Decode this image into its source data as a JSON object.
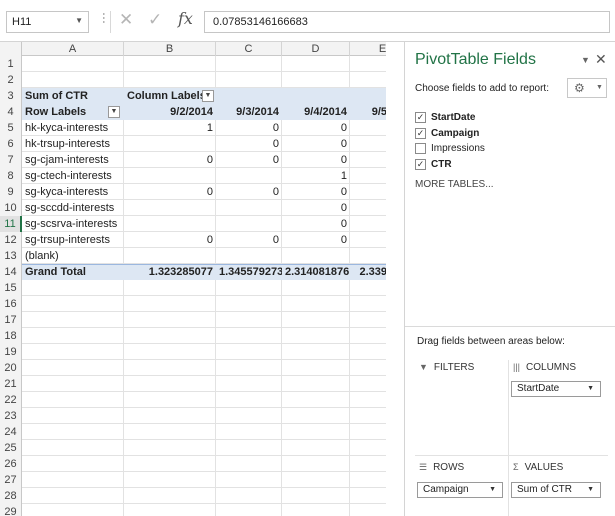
{
  "formula_bar": {
    "name_box": "H11",
    "formula": "0.07853146166683"
  },
  "grid": {
    "columns": [
      "A",
      "B",
      "C",
      "D",
      "E"
    ],
    "active_row": "11",
    "rows": [
      {
        "n": "1",
        "a": "",
        "b": "",
        "c": "",
        "d": "",
        "e": ""
      },
      {
        "n": "2",
        "a": "",
        "b": "",
        "c": "",
        "d": "",
        "e": ""
      },
      {
        "n": "3",
        "a": "Sum of CTR",
        "b": "Column Labels",
        "c": "",
        "d": "",
        "e": ""
      },
      {
        "n": "4",
        "a": "Row Labels",
        "b": "9/2/2014",
        "c": "9/3/2014",
        "d": "9/4/2014",
        "e": "9/5"
      },
      {
        "n": "5",
        "a": "hk-kyca-interests",
        "b": "1",
        "c": "0",
        "d": "0",
        "e": ""
      },
      {
        "n": "6",
        "a": "hk-trsup-interests",
        "b": "",
        "c": "0",
        "d": "0",
        "e": ""
      },
      {
        "n": "7",
        "a": "sg-cjam-interests",
        "b": "0",
        "c": "0",
        "d": "0",
        "e": ""
      },
      {
        "n": "8",
        "a": "sg-ctech-interests",
        "b": "",
        "c": "",
        "d": "1",
        "e": ""
      },
      {
        "n": "9",
        "a": "sg-kyca-interests",
        "b": "0",
        "c": "0",
        "d": "0",
        "e": ""
      },
      {
        "n": "10",
        "a": "sg-sccdd-interests",
        "b": "",
        "c": "",
        "d": "0",
        "e": ""
      },
      {
        "n": "11",
        "a": "sg-scsrva-interests",
        "b": "",
        "c": "",
        "d": "0",
        "e": ""
      },
      {
        "n": "12",
        "a": "sg-trsup-interests",
        "b": "0",
        "c": "0",
        "d": "0",
        "e": ""
      },
      {
        "n": "13",
        "a": "(blank)",
        "b": "",
        "c": "",
        "d": "",
        "e": ""
      },
      {
        "n": "14",
        "a": "Grand Total",
        "b": "1.323285077",
        "c": "1.345579273",
        "d": "2.314081876",
        "e": "2.339"
      },
      {
        "n": "15",
        "a": "",
        "b": "",
        "c": "",
        "d": "",
        "e": ""
      },
      {
        "n": "16",
        "a": "",
        "b": "",
        "c": "",
        "d": "",
        "e": ""
      },
      {
        "n": "17",
        "a": "",
        "b": "",
        "c": "",
        "d": "",
        "e": ""
      },
      {
        "n": "18",
        "a": "",
        "b": "",
        "c": "",
        "d": "",
        "e": ""
      },
      {
        "n": "19",
        "a": "",
        "b": "",
        "c": "",
        "d": "",
        "e": ""
      },
      {
        "n": "20",
        "a": "",
        "b": "",
        "c": "",
        "d": "",
        "e": ""
      },
      {
        "n": "21",
        "a": "",
        "b": "",
        "c": "",
        "d": "",
        "e": ""
      },
      {
        "n": "22",
        "a": "",
        "b": "",
        "c": "",
        "d": "",
        "e": ""
      },
      {
        "n": "23",
        "a": "",
        "b": "",
        "c": "",
        "d": "",
        "e": ""
      },
      {
        "n": "24",
        "a": "",
        "b": "",
        "c": "",
        "d": "",
        "e": ""
      },
      {
        "n": "25",
        "a": "",
        "b": "",
        "c": "",
        "d": "",
        "e": ""
      },
      {
        "n": "26",
        "a": "",
        "b": "",
        "c": "",
        "d": "",
        "e": ""
      },
      {
        "n": "27",
        "a": "",
        "b": "",
        "c": "",
        "d": "",
        "e": ""
      },
      {
        "n": "28",
        "a": "",
        "b": "",
        "c": "",
        "d": "",
        "e": ""
      },
      {
        "n": "29",
        "a": "",
        "b": "",
        "c": "",
        "d": "",
        "e": ""
      }
    ]
  },
  "pane": {
    "title": "PivotTable Fields",
    "subtitle": "Choose fields to add to report:",
    "fields": [
      {
        "label": "StartDate",
        "checked": true
      },
      {
        "label": "Campaign",
        "checked": true
      },
      {
        "label": "Impressions",
        "checked": false
      },
      {
        "label": "CTR",
        "checked": true
      }
    ],
    "more_tables": "MORE TABLES...",
    "areas_label": "Drag fields between areas below:",
    "filters": {
      "title": "FILTERS"
    },
    "columns": {
      "title": "COLUMNS",
      "chip": "StartDate"
    },
    "rows": {
      "title": "ROWS",
      "chip": "Campaign"
    },
    "values": {
      "title": "VALUES",
      "chip": "Sum of CTR"
    }
  },
  "colors": {
    "accent": "#217346",
    "pivot_header": "#dde7f3"
  }
}
